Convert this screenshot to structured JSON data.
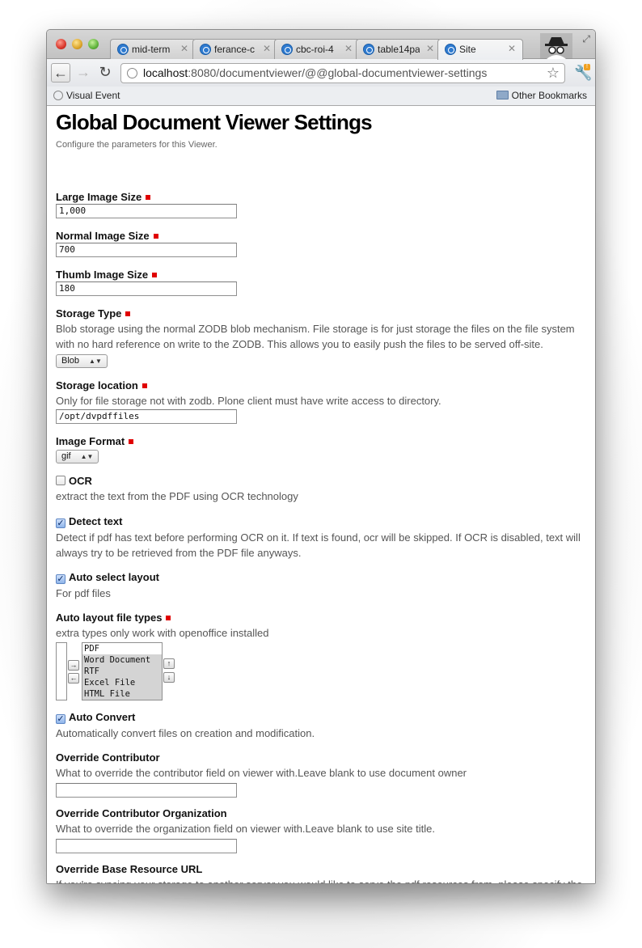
{
  "browser": {
    "tabs": [
      {
        "label": "mid-term",
        "active": false
      },
      {
        "label": "ferance-c",
        "active": false
      },
      {
        "label": "cbc-roi-4",
        "active": false
      },
      {
        "label": "table14pa",
        "active": false
      },
      {
        "label": "Site",
        "active": true
      }
    ],
    "url_host": "localhost",
    "url_rest": ":8080/documentviewer/@@global-documentviewer-settings",
    "bookmark_left": "Visual Event",
    "bookmark_right": "Other Bookmarks"
  },
  "page": {
    "title": "Global Document Viewer Settings",
    "description": "Configure the parameters for this Viewer."
  },
  "fields": {
    "large_image_size": {
      "label": "Large Image Size",
      "value": "1,000"
    },
    "normal_image_size": {
      "label": "Normal Image Size",
      "value": "700"
    },
    "thumb_image_size": {
      "label": "Thumb Image Size",
      "value": "180"
    },
    "storage_type": {
      "label": "Storage Type",
      "help": "Blob storage using the normal ZODB blob mechanism. File storage is for just storage the files on the file system with no hard reference on write to the ZODB. This allows you to easily push the files to be served off-site.",
      "value": "Blob"
    },
    "storage_location": {
      "label": "Storage location",
      "help": "Only for file storage not with zodb. Plone client must have write access to directory.",
      "value": "/opt/dvpdffiles"
    },
    "image_format": {
      "label": "Image Format",
      "value": "gif"
    },
    "ocr": {
      "label": "OCR",
      "help": "extract the text from the PDF using OCR technology",
      "checked": false
    },
    "detect_text": {
      "label": "Detect text",
      "help": "Detect if pdf has text before performing OCR on it. If text is found, ocr will be skipped. If OCR is disabled, text will always try to be retrieved from the PDF file anyways.",
      "checked": true
    },
    "auto_select_layout": {
      "label": "Auto select layout",
      "help": "For pdf files",
      "checked": true
    },
    "auto_layout_file_types": {
      "label": "Auto layout file types",
      "help": "extra types only work with openoffice installed",
      "options": [
        {
          "label": "PDF",
          "selected": false
        },
        {
          "label": "Word Document",
          "selected": true
        },
        {
          "label": "RTF",
          "selected": true
        },
        {
          "label": "Excel File",
          "selected": true
        },
        {
          "label": "HTML File",
          "selected": true
        }
      ]
    },
    "auto_convert": {
      "label": "Auto Convert",
      "help": "Automatically convert files on creation and modification.",
      "checked": true
    },
    "override_contributor": {
      "label": "Override Contributor",
      "help": "What to override the contributor field on viewer with.Leave blank to use document owner",
      "value": ""
    },
    "override_contributor_org": {
      "label": "Override Contributor Organization",
      "help": "What to override the organization field on viewer with.Leave blank to use site title.",
      "value": ""
    },
    "override_base_resource_url": {
      "label": "Override Base Resource URL",
      "help": "If you're syncing your storage to another server you would like to serve the pdf resources from, please specify the base url path.",
      "value": ""
    }
  }
}
